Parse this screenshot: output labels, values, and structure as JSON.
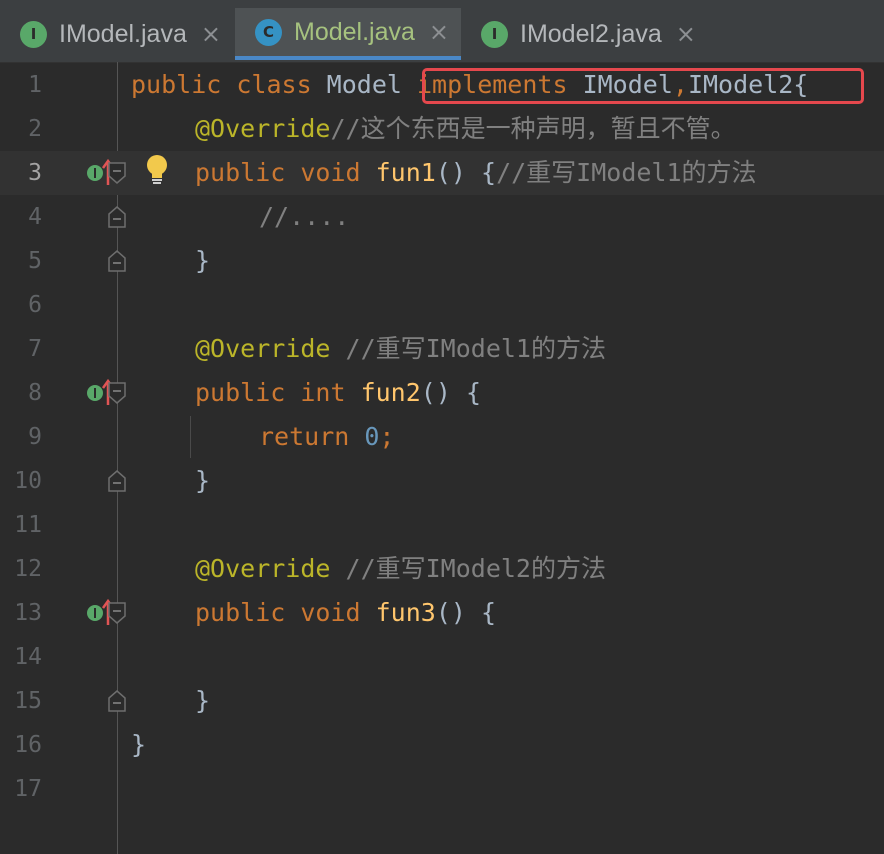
{
  "tabs": [
    {
      "label": "IModel.java",
      "icon": "I",
      "type": "interface"
    },
    {
      "label": "Model.java",
      "icon": "C",
      "type": "class",
      "active": true
    },
    {
      "label": "IModel2.java",
      "icon": "I",
      "type": "interface"
    }
  ],
  "close_glyph": "×",
  "editor": {
    "line_numbers": [
      "1",
      "2",
      "3",
      "4",
      "5",
      "6",
      "7",
      "8",
      "9",
      "10",
      "11",
      "12",
      "13",
      "14",
      "15",
      "16",
      "17"
    ],
    "current_line": "3",
    "lines": {
      "l1": {
        "kw1": "public class ",
        "name": "Model ",
        "kw2": "implements ",
        "rest": "IModel",
        "comma": ",",
        "rest2": "IModel2{"
      },
      "l2": {
        "ann": "@Override",
        "cm": "//这个东西是一种声明，暂且不管。"
      },
      "l3": {
        "kw": "public void ",
        "fn": "fun1",
        "punc": "() {",
        "cm": "//重写IModel1的方法"
      },
      "l4": {
        "cm": "//...."
      },
      "l5": {
        "punc": "}"
      },
      "l7": {
        "ann": "@Override",
        "cm": " //重写IModel1的方法"
      },
      "l8": {
        "kw": "public int ",
        "fn": "fun2",
        "punc": "() {"
      },
      "l9": {
        "kw": "return ",
        "num": "0",
        "semi": ";"
      },
      "l10": {
        "punc": "}"
      },
      "l12": {
        "ann": "@Override",
        "cm": " //重写IModel2的方法"
      },
      "l13": {
        "kw": "public void ",
        "fn": "fun3",
        "punc": "() {"
      },
      "l15": {
        "punc": "}"
      },
      "l16": {
        "punc": "}"
      }
    }
  },
  "colors": {
    "keyword": "#cc7832",
    "annotation": "#bbb529",
    "function": "#ffc66d",
    "comment": "#808080",
    "number": "#6897bb",
    "highlight_box": "#e5484d",
    "active_tab_underline": "#4a88c7"
  },
  "icons": {
    "implements_marker": "implements-method-icon",
    "intention": "lightbulb-icon",
    "fold": "fold-marker-icon"
  }
}
